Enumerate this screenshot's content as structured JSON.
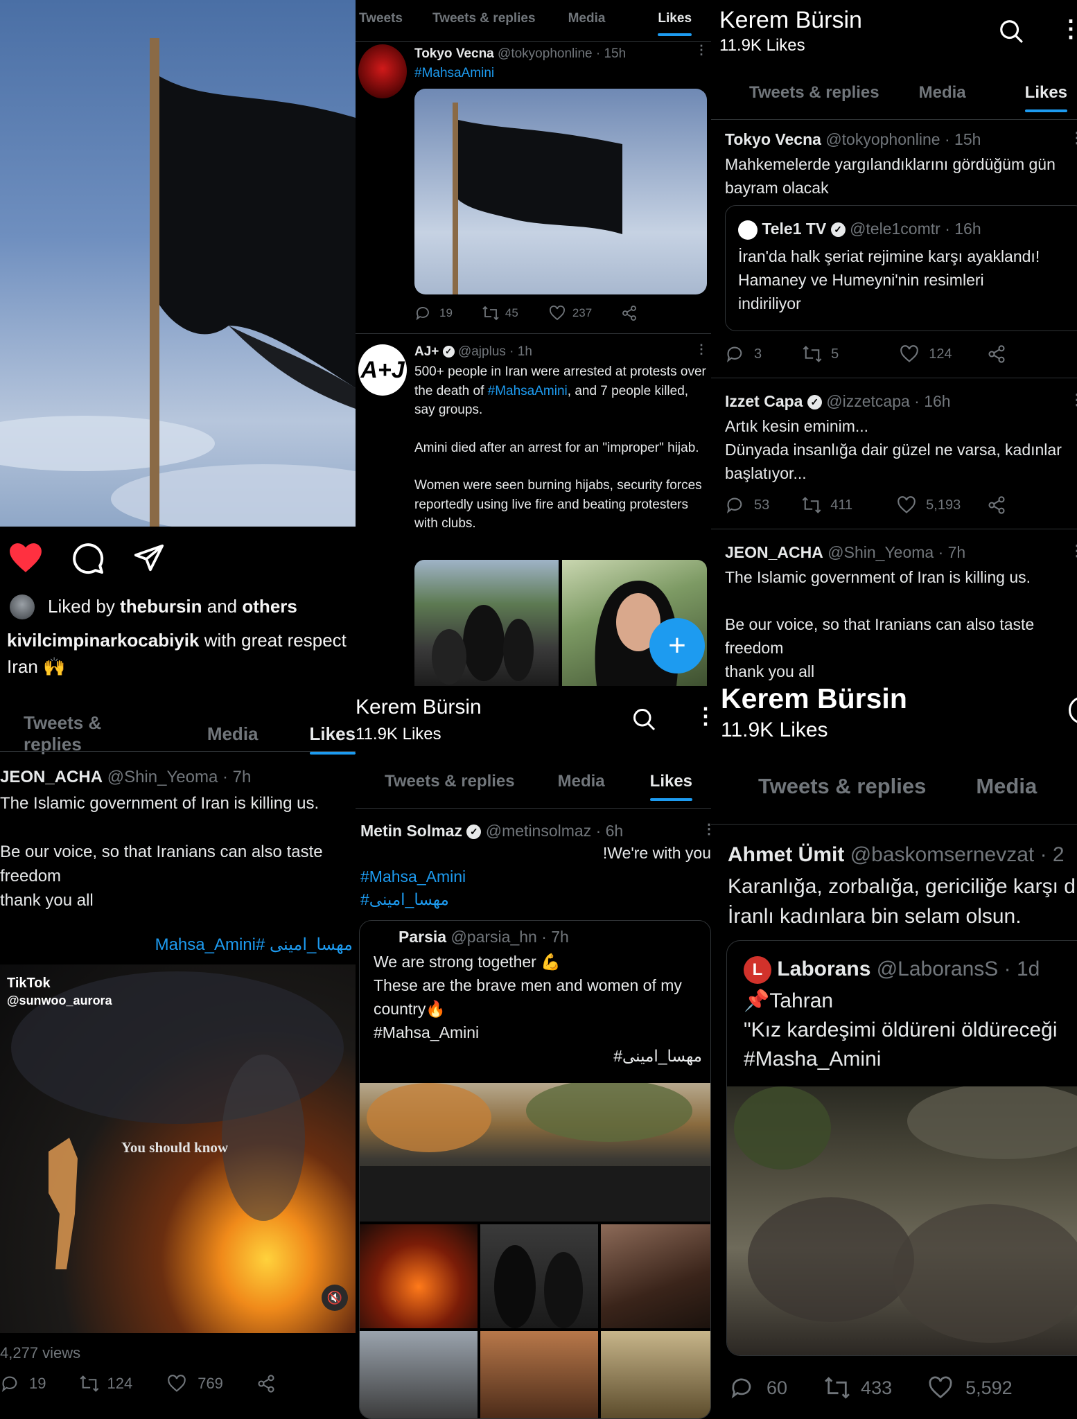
{
  "instagram": {
    "liked_by_prefix": "Liked by",
    "liked_by_user": "thebursin",
    "liked_by_and": "and",
    "liked_by_others": "others",
    "caption_user": "kivilcimpinarkocabiyik",
    "caption_text": "with great respect",
    "caption_line2": "Iran 🙌"
  },
  "col1_twitter": {
    "tabs": [
      "Tweets & replies",
      "Media",
      "Likes"
    ],
    "tweet": {
      "name": "JEON_ACHA",
      "handle": "@Shin_Yeoma",
      "time": "· 7h",
      "text": "The Islamic government of Iran is killing us.\n\nBe our voice, so that Iranians can also taste freedom\nthank you all",
      "hashtag": "Mahsa_Amini# مهسا_امینی",
      "tiktok_brand": "TikTok",
      "tiktok_user": "@sunwoo_aurora",
      "video_caption": "You should know",
      "views": "4,277 views",
      "replies": "19",
      "retweets": "124",
      "likes": "769"
    }
  },
  "col2_top": {
    "tabs": [
      "Tweets",
      "Tweets & replies",
      "Media",
      "Likes"
    ],
    "tweet1": {
      "name": "Tokyo Vecna",
      "handle": "@tokyophonline",
      "time": "· 15h",
      "hashtag": "#MahsaAmini",
      "replies": "19",
      "retweets": "45",
      "likes": "237"
    },
    "tweet2": {
      "name": "AJ+",
      "handle": "@ajplus",
      "time": "· 1h",
      "text_a": "500+ people in Iran were arrested at protests over the death of ",
      "text_link": "#MahsaAmini",
      "text_b": ", and 7 people killed, say groups.",
      "text_c": "Amini died after an arrest for an \"improper\" hijab.",
      "text_d": "Women were seen burning hijabs, security forces reportedly using live fire and beating protesters with clubs."
    },
    "fab_label": "+"
  },
  "col2_bottom": {
    "profile_name": "Kerem Bürsin",
    "likes_count": "11.9K Likes",
    "tabs": [
      "Tweets & replies",
      "Media",
      "Likes"
    ],
    "tweet": {
      "name": "Metin Solmaz",
      "handle": "@metinsolmaz",
      "time": "· 6h",
      "text": "!We're with you",
      "hashtag1": "#Mahsa_Amini",
      "hashtag2": "#مهسا_امینی",
      "quote": {
        "name": "Parsia",
        "handle": "@parsia_hn",
        "time": "· 7h",
        "text": "We are strong together 💪\n These are the brave men and women of my country🔥\n#Mahsa_Amini",
        "rtl": "#مهسا_امینی"
      }
    }
  },
  "col3_top": {
    "profile_name": "Kerem Bürsin",
    "likes_count": "11.9K Likes",
    "tabs": [
      "Tweets & replies",
      "Media",
      "Likes"
    ],
    "tweet1": {
      "name": "Tokyo Vecna",
      "handle": "@tokyophonline",
      "time": "· 15h",
      "text": "Mahkemelerde yargılandıklarını gördüğüm gün bayram olacak",
      "quote": {
        "name": "Tele1 TV",
        "handle": "@tele1comtr",
        "time": "· 16h",
        "text": "İran'da halk şeriat rejimine karşı ayaklandı! Hamaney ve Humeyni'nin resimleri indiriliyor"
      },
      "replies": "3",
      "retweets": "5",
      "likes": "124"
    },
    "tweet2": {
      "name": "Izzet Capa",
      "handle": "@izzetcapa",
      "time": "· 16h",
      "text": "Artık kesin eminim...\nDünyada insanlığa dair güzel ne varsa, kadınlar başlatıyor...",
      "replies": "53",
      "retweets": "411",
      "likes": "5,193"
    },
    "tweet3": {
      "name": "JEON_ACHA",
      "handle": "@Shin_Yeoma",
      "time": "· 7h",
      "text": "The Islamic government of Iran is killing us.\n\nBe our voice, so that Iranians can also taste freedom\nthank you all"
    }
  },
  "col3_bottom": {
    "profile_name": "Kerem Bürsin",
    "likes_count": "11.9K Likes",
    "tabs": [
      "Tweets & replies",
      "Media"
    ],
    "tweet": {
      "name": "Ahmet Ümit",
      "handle": "@baskomsernevzat",
      "time": "· 2",
      "text": "Karanlığa, zorbalığa, gericiliğe karşı d\nİranlı kadınlara bin selam olsun.",
      "quote": {
        "name": "Laborans",
        "handle": "@LaboransS",
        "time": "· 1d",
        "text": "📌Tahran\n\"Kız kardeşimi öldüreni öldüreceği\n#Masha_Amini"
      },
      "replies": "60",
      "retweets": "433",
      "likes": "5,592"
    }
  }
}
